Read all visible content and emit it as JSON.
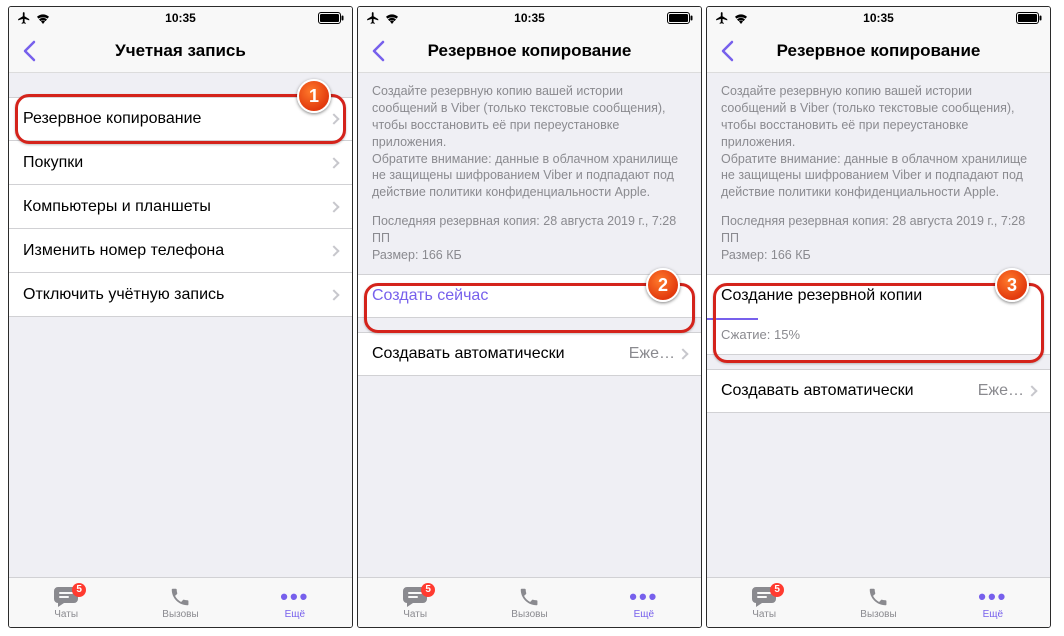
{
  "status": {
    "time": "10:35"
  },
  "colors": {
    "accent": "#7760ec",
    "highlight": "#d4231b"
  },
  "tabs": {
    "chats": "Чаты",
    "calls": "Вызовы",
    "more": "Ещё",
    "badge": "5"
  },
  "screen1": {
    "title": "Учетная запись",
    "rows": {
      "backup": "Резервное копирование",
      "purchases": "Покупки",
      "devices": "Компьютеры и планшеты",
      "change_number": "Изменить номер телефона",
      "deactivate": "Отключить учётную запись"
    }
  },
  "screen2": {
    "title": "Резервное копирование",
    "info": "Создайте резервную копию вашей истории сообщений в Viber (только текстовые сообщения), чтобы восстановить её при переустановке приложения.\nОбратите внимание: данные в облачном хранилище не защищены шифрованием Viber и подпадают под действие политики конфиденциальности Apple.",
    "last_backup_line1": "Последняя резервная копия: 28 августа 2019 г., 7:28 ПП",
    "last_backup_line2": "Размер: 166 КБ",
    "create_now": "Создать сейчас",
    "auto_label": "Создавать автоматически",
    "auto_value": "Еже…"
  },
  "screen3": {
    "title": "Резервное копирование",
    "creating": "Создание резервной копии",
    "compress": "Сжатие: 15%",
    "progress_percent": 15,
    "auto_label": "Создавать автоматически",
    "auto_value": "Еже…"
  },
  "markers": {
    "m1": "1",
    "m2": "2",
    "m3": "3"
  }
}
